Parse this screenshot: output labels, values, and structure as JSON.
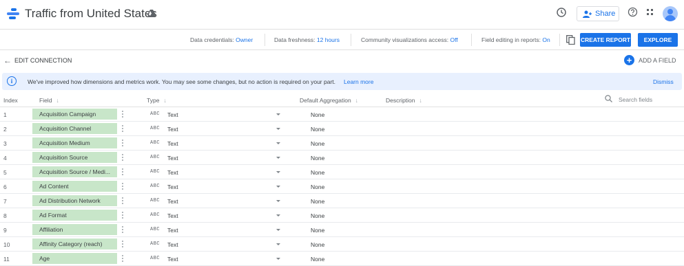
{
  "header": {
    "title": "Traffic from United States",
    "share_label": "Share",
    "icons": [
      "report-logo-icon",
      "drive-icon",
      "history-icon",
      "add-person-icon",
      "help-icon",
      "apps-grid-icon",
      "avatar"
    ]
  },
  "toolbar": {
    "credentials_label": "Data credentials:",
    "credentials_value": "Owner",
    "freshness_label": "Data freshness:",
    "freshness_value": "12 hours",
    "community_label": "Community visualizations access:",
    "community_value": "Off",
    "field_editing_label": "Field editing in reports:",
    "field_editing_value": "On",
    "create_report_label": "CREATE REPORT",
    "explore_label": "EXPLORE"
  },
  "edit_row": {
    "label": "EDIT CONNECTION",
    "add_field_label": "ADD A FIELD"
  },
  "banner": {
    "text": "We've improved how dimensions and metrics work. You may see some changes, but no action is required on your part.",
    "link": "Learn more",
    "dismiss": "Dismiss"
  },
  "table": {
    "columns": {
      "index": "Index",
      "field": "Field",
      "type": "Type",
      "default_aggregation": "Default Aggregation",
      "description": "Description"
    },
    "search_placeholder": "Search fields",
    "rows": [
      {
        "index": "1",
        "field": "Acquisition Campaign",
        "type_icon": "ABC",
        "type": "Text",
        "aggregation": "None"
      },
      {
        "index": "2",
        "field": "Acquisition Channel",
        "type_icon": "ABC",
        "type": "Text",
        "aggregation": "None"
      },
      {
        "index": "3",
        "field": "Acquisition Medium",
        "type_icon": "ABC",
        "type": "Text",
        "aggregation": "None"
      },
      {
        "index": "4",
        "field": "Acquisition Source",
        "type_icon": "ABC",
        "type": "Text",
        "aggregation": "None"
      },
      {
        "index": "5",
        "field": "Acquisition Source / Medi...",
        "type_icon": "ABC",
        "type": "Text",
        "aggregation": "None"
      },
      {
        "index": "6",
        "field": "Ad Content",
        "type_icon": "ABC",
        "type": "Text",
        "aggregation": "None"
      },
      {
        "index": "7",
        "field": "Ad Distribution Network",
        "type_icon": "ABC",
        "type": "Text",
        "aggregation": "None"
      },
      {
        "index": "8",
        "field": "Ad Format",
        "type_icon": "ABC",
        "type": "Text",
        "aggregation": "None"
      },
      {
        "index": "9",
        "field": "Affiliation",
        "type_icon": "ABC",
        "type": "Text",
        "aggregation": "None"
      },
      {
        "index": "10",
        "field": "Affinity Category (reach)",
        "type_icon": "ABC",
        "type": "Text",
        "aggregation": "None"
      },
      {
        "index": "11",
        "field": "Age",
        "type_icon": "ABC",
        "type": "Text",
        "aggregation": "None"
      }
    ]
  },
  "colors": {
    "accent": "#1a73e8",
    "field_chip": "#c8e6c9",
    "banner_bg": "#e8f0fe"
  }
}
